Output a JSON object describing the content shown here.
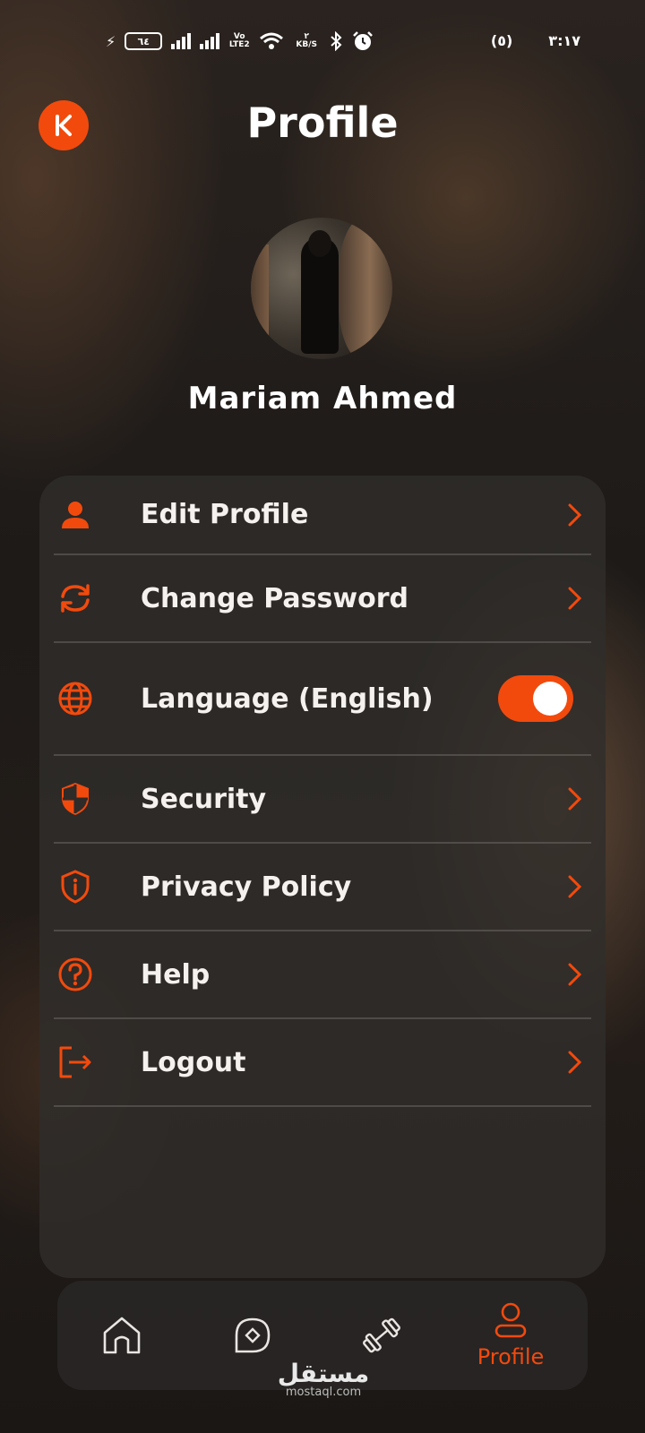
{
  "status_bar": {
    "battery": "٦٤",
    "network_speed_value": "٢",
    "network_speed_unit": "KB/S",
    "volte_label": "Vo LTE2",
    "notification_count": "(٥)",
    "time": "٣:١٧"
  },
  "header": {
    "title": "Profile"
  },
  "profile": {
    "name": "Mariam  Ahmed"
  },
  "menu": {
    "items": [
      {
        "label": "Edit Profile",
        "icon": "person-icon"
      },
      {
        "label": "Change Password",
        "icon": "refresh-icon"
      },
      {
        "label": "Language (English)",
        "icon": "globe-icon",
        "toggle_on": true
      },
      {
        "label": "Security",
        "icon": "shield-icon"
      },
      {
        "label": "Privacy Policy",
        "icon": "shield-info-icon"
      },
      {
        "label": "Help",
        "icon": "question-icon"
      },
      {
        "label": "Logout",
        "icon": "logout-icon"
      }
    ]
  },
  "bottom_nav": {
    "items": [
      {
        "icon": "home-icon",
        "label": ""
      },
      {
        "icon": "compass-icon",
        "label": ""
      },
      {
        "icon": "dumbbell-icon",
        "label": ""
      },
      {
        "icon": "profile-icon",
        "label": "Profile",
        "active": true
      }
    ]
  },
  "watermark": {
    "arabic": "مستقل",
    "latin": "mostaql.com"
  },
  "colors": {
    "accent": "#f24a0d",
    "card": "#302d2b",
    "text": "#ffffff"
  }
}
